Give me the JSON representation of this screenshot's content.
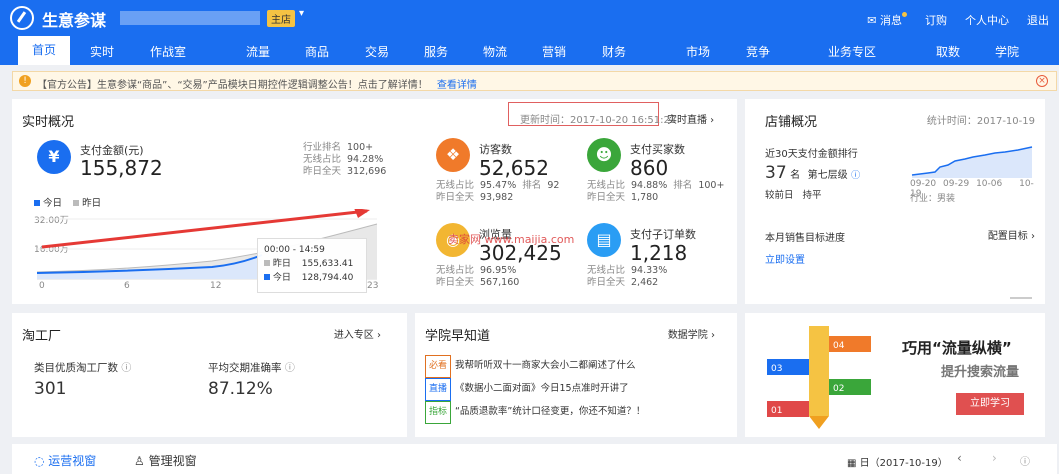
{
  "app": {
    "brand": "生意参谋",
    "badge": "主店",
    "links": [
      "消息",
      "订购",
      "个人中心",
      "退出"
    ]
  },
  "nav": {
    "items": [
      "首页",
      "实时",
      "作战室",
      "流量",
      "商品",
      "交易",
      "服务",
      "物流",
      "营销",
      "财务",
      "市场",
      "竞争",
      "业务专区",
      "取数",
      "学院"
    ]
  },
  "notice": {
    "text": "【官方公告】生意参谋“商品”、“交易”产品模块日期控件逻辑调整公告！点击了解详情！",
    "link": "查看详情"
  },
  "realtime": {
    "title": "实时概况",
    "update": "更新时间：2017-10-20 16:51:23",
    "live": "实时直播",
    "pay_label": "支付金额(元)",
    "pay_value": "155,872",
    "rank_label": "行业排名",
    "rank_value": "100+",
    "wireless_label": "无线占比",
    "wireless_value": "94.28%",
    "yesterday_label": "昨日全天",
    "yesterday_value": "312,696",
    "legend_today": "今日",
    "legend_yesterday": "昨日",
    "y1": "32.00万",
    "y2": "16.00万",
    "x": [
      "0",
      "6",
      "12",
      "23"
    ],
    "tooltip_time": "00:00 - 14:59",
    "tooltip_yesterday_label": "昨日",
    "tooltip_yesterday": "155,633.41",
    "tooltip_today_label": "今日",
    "tooltip_today": "128,794.40",
    "visitors_label": "访客数",
    "visitors": "52,652",
    "v_wireless": "95.47%",
    "v_rank_label": "排名",
    "v_rank": "92",
    "v_yesterday": "93,982",
    "buyers_label": "支付买家数",
    "buyers": "860",
    "b_wireless": "94.88%",
    "b_rank_label": "排名",
    "b_rank": "100+",
    "b_yesterday": "1,780",
    "views_label": "浏览量",
    "views": "302,425",
    "pv_wireless": "96.95%",
    "pv_yesterday": "567,160",
    "orders_label": "支付子订单数",
    "orders": "1,218",
    "o_wireless": "94.33%",
    "o_yesterday": "2,462",
    "watermark": "卖家网 www.maijia.com"
  },
  "store": {
    "title": "店铺概况",
    "stat_time": "统计时间：2017-10-19",
    "rank_title": "近30天支付金额排行",
    "rank_num": "37",
    "rank_unit": "名",
    "level": "第七层级",
    "compare_label": "较前日",
    "compare_value": "持平",
    "dates": [
      "09-20",
      "09-29",
      "10-06",
      "10-19"
    ],
    "industry": "行业：男装",
    "target_title": "本月销售目标进度",
    "target_link": "配置目标",
    "setup": "立即设置"
  },
  "factory": {
    "title": "淘工厂",
    "enter": "进入专区",
    "m1_label": "类目优质淘工厂数",
    "m1_value": "301",
    "m2_label": "平均交期准确率",
    "m2_value": "87.12%"
  },
  "academy": {
    "title": "学院早知道",
    "link": "数据学院",
    "items": [
      {
        "tag": "必看",
        "text": "我帮听听双十一商家大会小二都阐述了什么"
      },
      {
        "tag": "直播",
        "text": "《数据小二面对面》今日15点准时开讲了"
      },
      {
        "tag": "指标",
        "text": "“品质退款率”统计口径变更，你还不知道？！"
      }
    ]
  },
  "ad": {
    "title": "巧用“流量纵横”",
    "subtitle": "提升搜索流量",
    "button": "立即学习",
    "labels": [
      "01",
      "02",
      "03",
      "04"
    ]
  },
  "bottom": {
    "tab1": "运营视窗",
    "tab2": "管理视窗",
    "date": "日（2017-10-19）"
  }
}
